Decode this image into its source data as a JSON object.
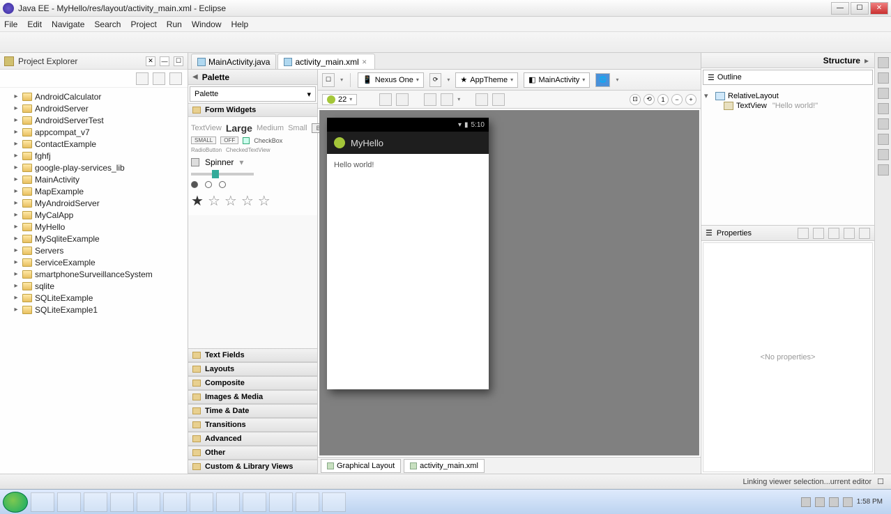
{
  "window": {
    "title": "Java EE - MyHello/res/layout/activity_main.xml - Eclipse"
  },
  "menu": [
    "File",
    "Edit",
    "Navigate",
    "Search",
    "Project",
    "Run",
    "Window",
    "Help"
  ],
  "projectExplorer": {
    "title": "Project Explorer",
    "items": [
      "AndroidCalculator",
      "AndroidServer",
      "AndroidServerTest",
      "appcompat_v7",
      "ContactExample",
      "fghfj",
      "google-play-services_lib",
      "MainActivity",
      "MapExample",
      "MyAndroidServer",
      "MyCalApp",
      "MyHello",
      "MySqliteExample",
      "Servers",
      "ServiceExample",
      "smartphoneSurveillanceSystem",
      "sqlite",
      "SQLiteExample",
      "SQLiteExample1"
    ]
  },
  "editorTabs": [
    {
      "label": "MainActivity.java"
    },
    {
      "label": "activity_main.xml"
    }
  ],
  "palette": {
    "header": "Palette",
    "combo": "Palette",
    "sections": {
      "formWidgets": "Form Widgets",
      "textFields": "Text Fields",
      "layouts": "Layouts",
      "composite": "Composite",
      "imagesMedia": "Images & Media",
      "timeDate": "Time & Date",
      "transitions": "Transitions",
      "advanced": "Advanced",
      "other": "Other",
      "custom": "Custom & Library Views"
    },
    "widgets": {
      "textview": "TextView",
      "large": "Large",
      "medium": "Medium",
      "small": "Small",
      "button": "BUTTON",
      "smallBtn": "SMALL",
      "off": "OFF",
      "checkbox": "CheckBox",
      "radio": "RadioButton",
      "checkedTv": "CheckedTextView",
      "spinner": "Spinner"
    }
  },
  "canvasToolbar": {
    "device": "Nexus One",
    "theme": "AppTheme",
    "activity": "MainActivity",
    "api": "22"
  },
  "preview": {
    "time": "5:10",
    "appName": "MyHello",
    "bodyText": "Hello world!"
  },
  "bottomTabs": [
    "Graphical Layout",
    "activity_main.xml"
  ],
  "structure": {
    "title": "Structure",
    "outline": "Outline",
    "root": "RelativeLayout",
    "child": "TextView",
    "childMeta": "\"Hello world!\"",
    "properties": "Properties",
    "noProps": "<No properties>"
  },
  "status": "Linking viewer selection...urrent editor",
  "tray": {
    "time": "1:58 PM"
  }
}
